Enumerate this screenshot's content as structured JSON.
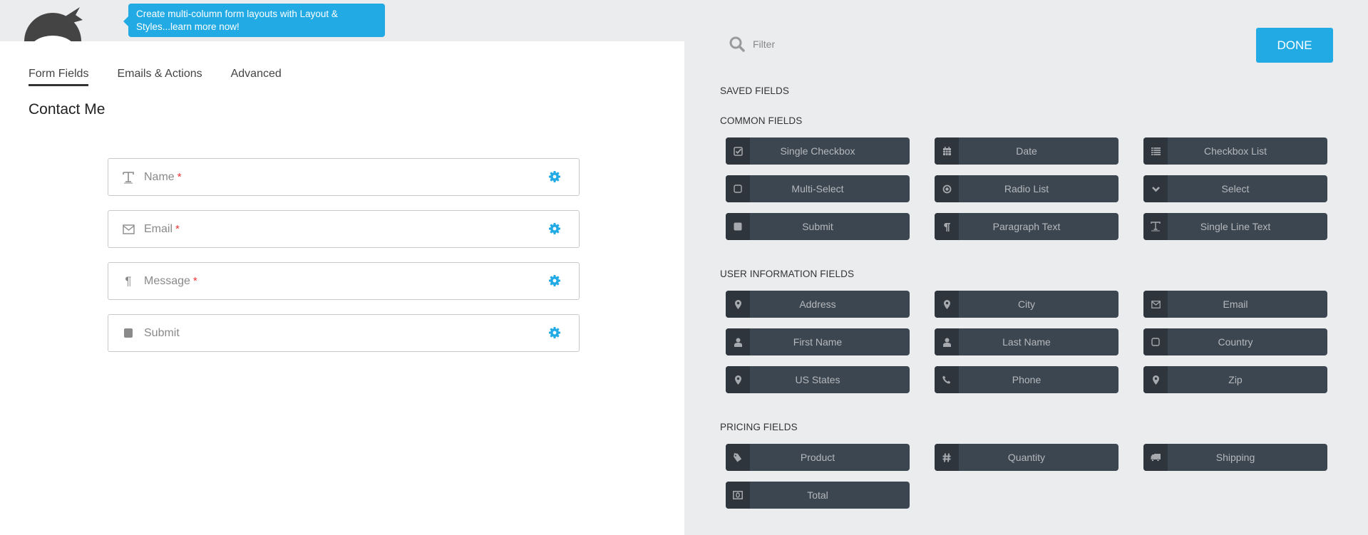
{
  "tooltip": {
    "text": "Create multi-column form layouts with Layout & Styles...learn more now!"
  },
  "tabs": [
    {
      "label": "Form Fields",
      "active": true
    },
    {
      "label": "Emails & Actions",
      "active": false
    },
    {
      "label": "Advanced",
      "active": false
    }
  ],
  "form": {
    "title": "Contact Me",
    "fields": [
      {
        "label": "Name",
        "required": "*",
        "icon": "text-cursor-icon"
      },
      {
        "label": "Email",
        "required": "*",
        "icon": "envelope-icon"
      },
      {
        "label": "Message",
        "required": "*",
        "icon": "paragraph-icon"
      },
      {
        "label": "Submit",
        "required": "",
        "icon": "square-icon"
      }
    ]
  },
  "filter": {
    "placeholder": "Filter"
  },
  "done_label": "DONE",
  "sections": {
    "saved": "SAVED FIELDS",
    "common": "COMMON FIELDS",
    "user_info": "USER INFORMATION FIELDS",
    "pricing": "PRICING FIELDS"
  },
  "common_fields": [
    {
      "label": "Single Checkbox",
      "icon": "checkbox-checked-icon"
    },
    {
      "label": "Date",
      "icon": "calendar-icon"
    },
    {
      "label": "Checkbox List",
      "icon": "list-icon"
    },
    {
      "label": "Multi-Select",
      "icon": "square-outline-icon"
    },
    {
      "label": "Radio List",
      "icon": "radio-icon"
    },
    {
      "label": "Select",
      "icon": "chevron-down-icon"
    },
    {
      "label": "Submit",
      "icon": "square-icon"
    },
    {
      "label": "Paragraph Text",
      "icon": "paragraph-icon"
    },
    {
      "label": "Single Line Text",
      "icon": "text-cursor-icon"
    }
  ],
  "user_info_fields": [
    {
      "label": "Address",
      "icon": "map-marker-icon"
    },
    {
      "label": "City",
      "icon": "map-marker-icon"
    },
    {
      "label": "Email",
      "icon": "envelope-icon"
    },
    {
      "label": "First Name",
      "icon": "user-icon"
    },
    {
      "label": "Last Name",
      "icon": "user-icon"
    },
    {
      "label": "Country",
      "icon": "square-outline-icon"
    },
    {
      "label": "US States",
      "icon": "map-marker-icon"
    },
    {
      "label": "Phone",
      "icon": "phone-icon"
    },
    {
      "label": "Zip",
      "icon": "map-marker-icon"
    }
  ],
  "pricing_fields": [
    {
      "label": "Product",
      "icon": "tag-icon"
    },
    {
      "label": "Quantity",
      "icon": "hashtag-icon"
    },
    {
      "label": "Shipping",
      "icon": "truck-icon"
    },
    {
      "label": "Total",
      "icon": "money-icon"
    }
  ],
  "colors": {
    "accent": "#22aae4",
    "button_bg": "#3c4650",
    "button_icon_bg": "#2e353d",
    "required": "#ee3333"
  }
}
